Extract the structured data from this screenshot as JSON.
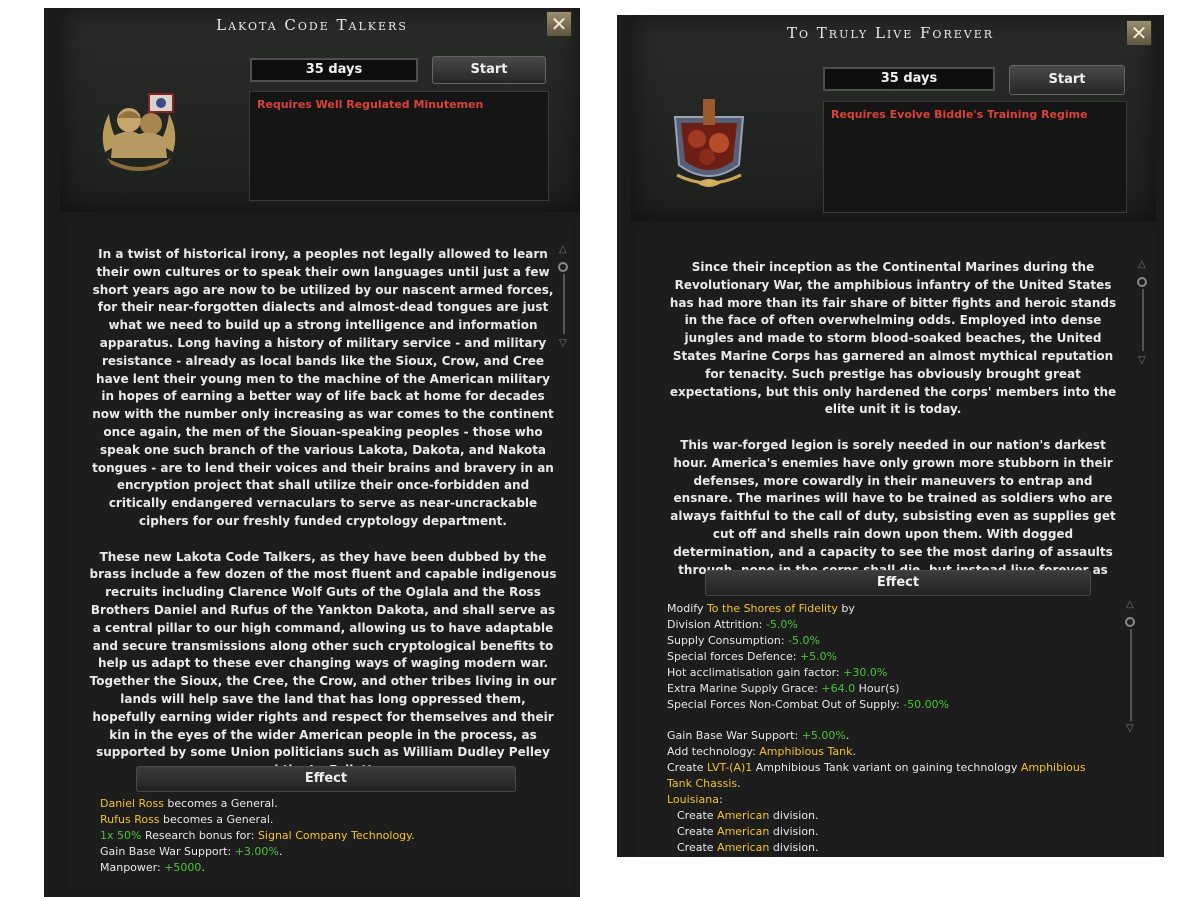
{
  "left": {
    "title": "Lakota Code Talkers",
    "days": "35 days",
    "start_label": "Start",
    "requirement": "Requires Well Regulated Minutemen",
    "description": [
      "In a twist of historical irony, a peoples not legally allowed to learn their own cultures or to speak their own languages until just a few short years ago are now to be utilized by our nascent armed forces, for their near-forgotten dialects and almost-dead tongues are just what we need to build up a strong intelligence and information apparatus. Long having a history of military service - and military resistance - already as local bands like the Sioux, Crow, and Cree have lent their young men to the machine of the American military in hopes of earning a better way of life back at home for decades now with the number only increasing as war comes to the continent once again, the men of the Siouan-speaking peoples - those who speak one such branch of the various Lakota, Dakota, and Nakota tongues - are to lend their voices and their brains and bravery in an encryption project that shall utilize their once-forbidden and critically endangered vernaculars to serve as near-uncrackable ciphers for our freshly funded cryptology department.",
      "These new Lakota Code Talkers, as they have been dubbed by the brass include a few dozen of the most fluent and capable indigenous recruits including Clarence Wolf Guts of the Oglala and the Ross Brothers Daniel and Rufus of the Yankton Dakota, and shall serve as a central pillar to our high command, allowing us to have adaptable and secure transmissions along other such cryptological benefits to help us adapt to these ever changing ways of waging modern war. Together the Sioux, the Cree, the Crow, and other tribes living in our lands will help save the land that has long oppressed them, hopefully earning wider rights and respect for themselves and their kin in the eyes of the wider American people in the process, as supported by some Union politicians such as William Dudley Pelley and the La Follettes."
    ],
    "effect_label": "Effect",
    "effects": {
      "l1_name": "Daniel Ross",
      "l1_text": " becomes a General.",
      "l2_name": "Rufus Ross",
      "l2_text": " becomes a General.",
      "l3_count": "1x",
      "l3_pct": "50%",
      "l3_text": " Research bonus for: ",
      "l3_tech": "Signal Company Technology",
      "l3_end": ".",
      "l4_text": "Gain Base War Support: ",
      "l4_val": "+3.00%",
      "l4_end": ".",
      "l5_text": "Manpower: ",
      "l5_val": "+5000",
      "l5_end": "."
    }
  },
  "right": {
    "title": "To Truly Live Forever",
    "days": "35 days",
    "start_label": "Start",
    "requirement": "Requires Evolve Biddle's Training Regime",
    "description": [
      "Since their inception as the Continental Marines during the Revolutionary War, the amphibious infantry of the United States has had more than its fair share of bitter fights and heroic stands in the face of often overwhelming odds. Employed into dense jungles and made to storm blood-soaked beaches, the United States Marine Corps has garnered an almost mythical reputation for tenacity. Such prestige has obviously brought great expectations, but this only hardened the corps' members into the elite unit it is today.",
      "This war-forged legion is sorely needed in our nation's darkest hour. America's enemies have only grown more stubborn in their defenses, more cowardly in their maneuvers to entrap and ensnare. The marines will have to be trained as soldiers who are always faithful to the call of duty, subsisting even as supplies get cut off and shells rain down upon them. With dogged determination, and a capacity to see the most daring of assaults through, none in the corps shall die, but instead live forever as examples of the best fighting men that America has."
    ],
    "effect_label": "Effect",
    "effects": {
      "modify_text": "Modify ",
      "modify_name": "To the Shores of Fidelity",
      "modify_end": " by",
      "m1_text": "Division Attrition: ",
      "m1_val": "-5.0%",
      "m2_text": "Supply Consumption: ",
      "m2_val": "-5.0%",
      "m3_text": "Special forces Defence: ",
      "m3_val": "+5.0%",
      "m4_text": "Hot acclimatisation gain factor: ",
      "m4_val": "+30.0%",
      "m5_text": "Extra Marine Supply Grace: ",
      "m5_val": "+64.0",
      "m5_unit": " Hour(s)",
      "m6_text": "Special Forces Non-Combat Out of Supply: ",
      "m6_val": "-50.00%",
      "e1_text": "Gain Base War Support: ",
      "e1_val": "+5.00%",
      "e1_end": ".",
      "e2_text": "Add technology: ",
      "e2_val": "Amphibious Tank",
      "e2_end": ".",
      "e3_text": "Create ",
      "e3_val": "LVT-(A)1",
      "e3_mid": " Amphibious Tank variant on gaining technology ",
      "e3_tech1": "Amphibious",
      "e3_tech2": "Tank Chassis",
      "e3_end": ".",
      "e4_state": "Louisiana",
      "e4_end": ":",
      "c_text": "Create ",
      "c_val": "American",
      "c_end": " division."
    }
  }
}
